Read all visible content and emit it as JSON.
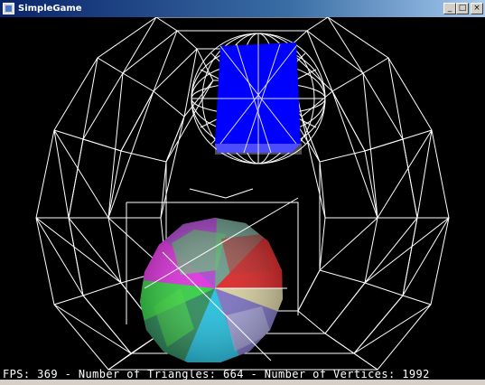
{
  "window": {
    "title": "SimpleGame",
    "controls": {
      "minimize": "_",
      "maximize": "□",
      "close": "×"
    }
  },
  "hud": {
    "fps_label": "FPS: ",
    "fps": "369",
    "sep1": " - ",
    "triangles_label": "Number of Triangles: ",
    "triangles": "664",
    "sep2": " - ",
    "vertices_label": "Number of Vertices: ",
    "vertices": "1992"
  },
  "scene": {
    "background_color": "#000000",
    "wireframe_color": "#ffffff",
    "box_color": "#0000ff",
    "objects": [
      {
        "name": "outer-wireframe-sphere",
        "kind": "wireframe"
      },
      {
        "name": "blue-box-in-wire-sphere",
        "kind": "solid"
      },
      {
        "name": "vertex-colored-sphere",
        "kind": "vertex-colored"
      }
    ]
  }
}
